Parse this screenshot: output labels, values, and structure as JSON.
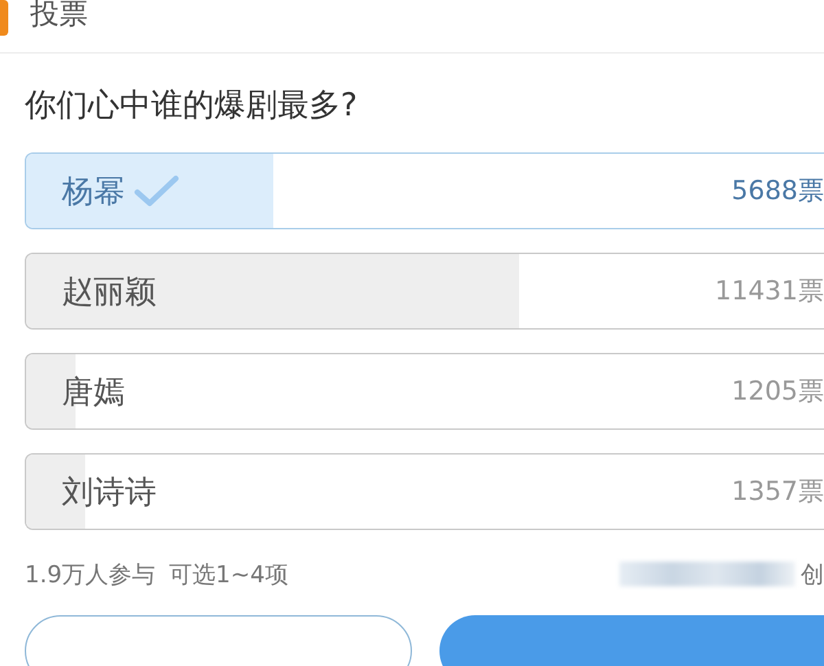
{
  "header": {
    "title": "投票"
  },
  "question": "你们心中谁的爆剧最多?",
  "options": [
    {
      "name": "杨幂",
      "votes": "5688票",
      "level": 0.3,
      "selected": true
    },
    {
      "name": "赵丽颖",
      "votes": "11431票",
      "level": 0.6,
      "selected": false
    },
    {
      "name": "唐嫣",
      "votes": "1205票",
      "level": 0.06,
      "selected": false
    },
    {
      "name": "刘诗诗",
      "votes": "1357票",
      "level": 0.072,
      "selected": false
    }
  ],
  "footer": {
    "participants": "1.9万人参与",
    "choice_rule": "可选1~4项",
    "creator_suffix": "创"
  },
  "buttons": [
    {
      "kind": "outline"
    },
    {
      "kind": "primary"
    }
  ]
}
